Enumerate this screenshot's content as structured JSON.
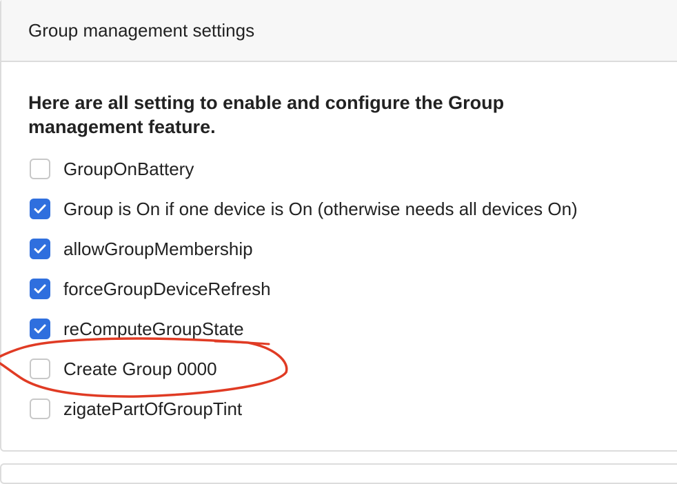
{
  "card": {
    "title": "Group management settings",
    "intro": "Here are all setting to enable and configure the Group management feature."
  },
  "options": [
    {
      "label": "GroupOnBattery",
      "checked": false
    },
    {
      "label": "Group is On if one device is On (otherwise needs all devices On)",
      "checked": true
    },
    {
      "label": "allowGroupMembership",
      "checked": true
    },
    {
      "label": "forceGroupDeviceRefresh",
      "checked": true
    },
    {
      "label": "reComputeGroupState",
      "checked": true
    },
    {
      "label": "Create Group 0000",
      "checked": false
    },
    {
      "label": "zigatePartOfGroupTint",
      "checked": false
    }
  ],
  "colors": {
    "accent": "#2f6fde",
    "annotation": "#e03b24"
  },
  "icons": {
    "check": "check-icon"
  }
}
